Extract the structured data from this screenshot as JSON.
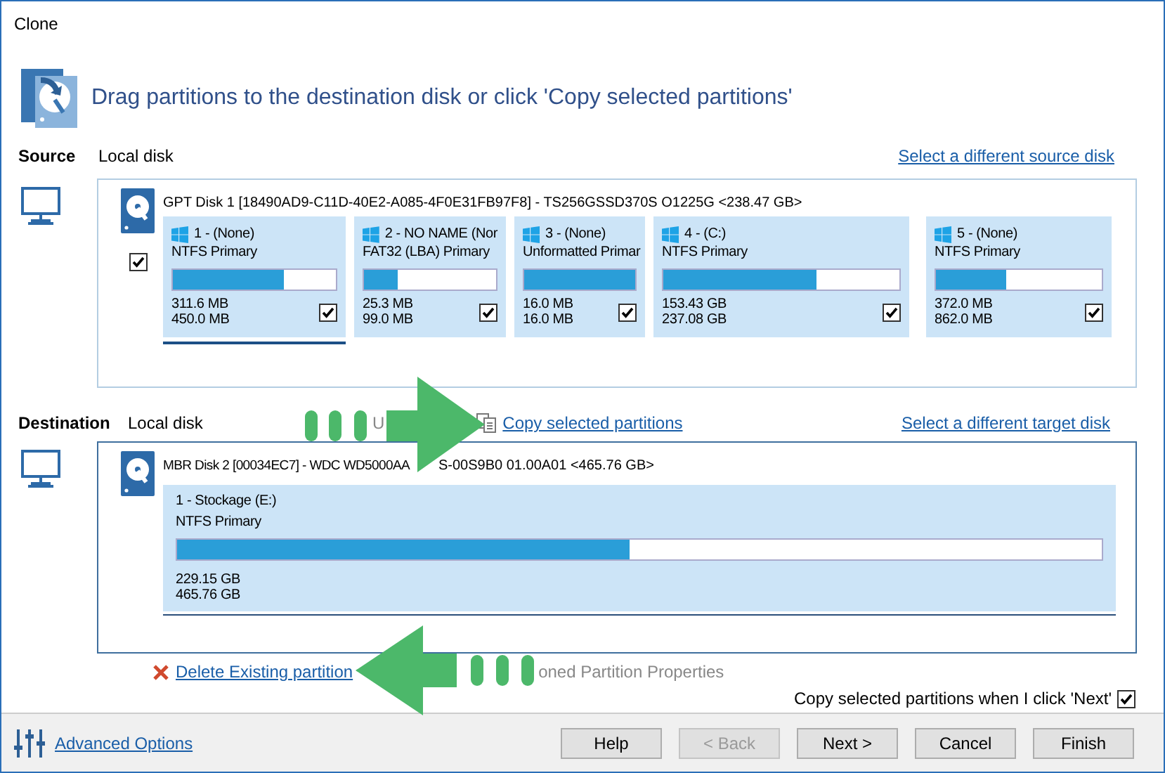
{
  "window": {
    "title": "Clone"
  },
  "header": {
    "instruction": "Drag partitions to the destination disk or click 'Copy selected partitions'"
  },
  "source": {
    "label": "Source",
    "disk_type": "Local disk",
    "link": "Select a different source disk",
    "disk": {
      "title": "GPT Disk 1 [18490AD9-C11D-40E2-A085-4F0E31FB97F8] - TS256GSSD370S O1225G  <238.47 GB>",
      "checked": true,
      "partitions": [
        {
          "name": "1 -  (None)",
          "fs": "NTFS Primary",
          "level": 0.68,
          "used": "311.6 MB",
          "total": "450.0 MB",
          "checked": true,
          "selected": true
        },
        {
          "name": "2 - NO NAME (Nor",
          "fs": "FAT32 (LBA) Primary",
          "level": 0.25,
          "used": "25.3 MB",
          "total": "99.0 MB",
          "checked": true,
          "selected": false
        },
        {
          "name": "3 -  (None)",
          "fs": "Unformatted Primar",
          "level": 1,
          "used": "16.0 MB",
          "total": "16.0 MB",
          "checked": true,
          "selected": false
        },
        {
          "name": "4 -  (C:)",
          "fs": "NTFS Primary",
          "level": 0.65,
          "used": "153.43 GB",
          "total": "237.08 GB",
          "checked": true,
          "selected": false
        },
        {
          "name": "5 -  (None)",
          "fs": "NTFS Primary",
          "level": 0.42,
          "used": "372.0 MB",
          "total": "862.0 MB",
          "checked": true,
          "selected": false
        }
      ]
    }
  },
  "destination": {
    "label": "Destination",
    "disk_type": "Local disk",
    "undo_text": "U",
    "copy_link": "Copy selected partitions",
    "link": "Select a different target disk",
    "disk": {
      "title_before": "MBR Disk 2 [00034EC7] - WDC WD5000AA",
      "title_after": "S-00S9B0 01.00A01  <465.76 GB>",
      "partitions": [
        {
          "name": "1 - Stockage (E:)",
          "fs": "NTFS Primary",
          "level": 0.49,
          "used": "229.15 GB",
          "total": "465.76 GB"
        }
      ]
    }
  },
  "actions": {
    "delete_link": "Delete Existing partition",
    "properties_text": "oned Partition Properties"
  },
  "copy_on_next": {
    "label": "Copy selected partitions when I click 'Next'",
    "checked": true
  },
  "footer": {
    "advanced_link": "Advanced Options",
    "buttons": [
      {
        "label": "Help",
        "disabled": false
      },
      {
        "label": "< Back",
        "disabled": true
      },
      {
        "label": "Next >",
        "disabled": false
      },
      {
        "label": "Cancel",
        "disabled": false
      },
      {
        "label": "Finish",
        "disabled": false
      }
    ]
  }
}
